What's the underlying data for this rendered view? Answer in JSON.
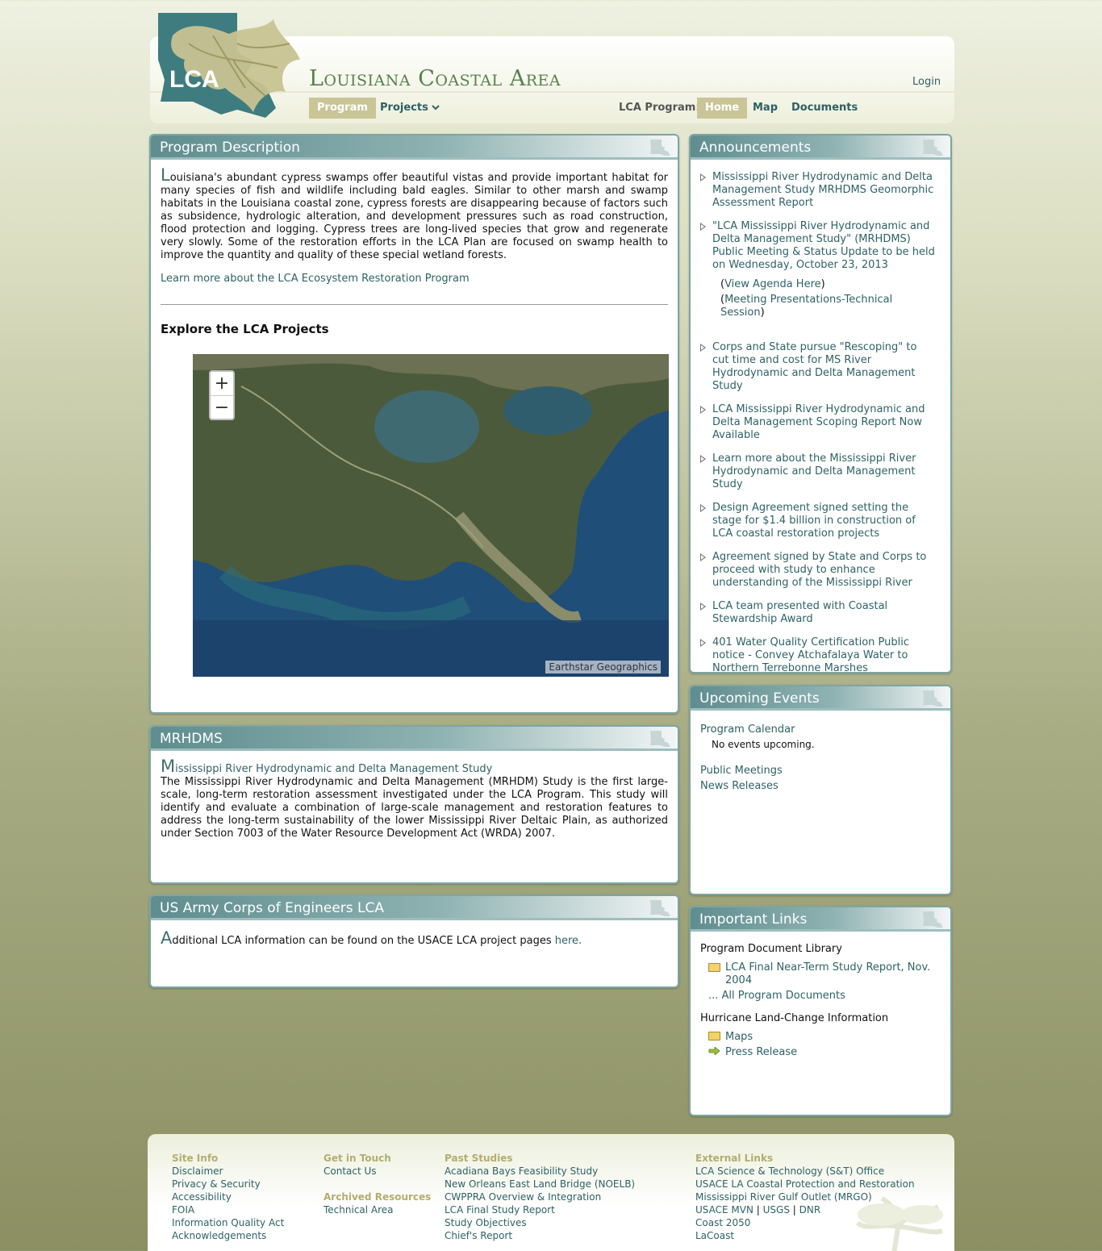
{
  "header": {
    "site_title": "Louisiana Coastal Area",
    "logo_text": "LCA",
    "login": "Login",
    "nav": {
      "program": "Program",
      "projects": "Projects",
      "label": "LCA Program:",
      "home": "Home",
      "map": "Map",
      "documents": "Documents"
    }
  },
  "program": {
    "title": "Program Description",
    "dropcap": "L",
    "text": "ouisiana's abundant cypress swamps offer beautiful vistas and provide important habitat for many species of fish and wildlife including bald eagles. Similar to other marsh and swamp habitats in the Louisiana coastal zone, cypress forests are disappearing because of factors such as subsidence, hydrologic alteration, and development pressures such as road construction, flood protection and logging. Cypress trees are long-lived species that grow and regenerate very slowly. Some of the restoration efforts in the LCA Plan are focused on swamp health to improve the quantity and quality of these special wetland forests.",
    "learn_more": "Learn more about the LCA Ecosystem Restoration Program",
    "explore": "Explore the LCA Projects",
    "map_attribution": "Earthstar Geographics",
    "zoom_in": "+",
    "zoom_out": "−"
  },
  "mrhdms": {
    "title": "MRHDMS",
    "dropcap": "M",
    "link": "ississippi River Hydrodynamic and Delta Management Study",
    "text": "The Mississippi River Hydrodynamic and Delta Management (MRHDM) Study is the first large-scale, long-term restoration assessment investigated under the LCA Program. This study will identify and evaluate a combination of large-scale management and restoration features to address the long-term sustainability of the lower Mississippi River Deltaic Plain, as authorized under Section 7003 of the Water Resource Development Act (WRDA) 2007."
  },
  "usace": {
    "title": "US Army Corps of Engineers LCA",
    "dropcap": "A",
    "text": "dditional LCA information can be found on the USACE LCA project pages ",
    "link": "here."
  },
  "announcements": {
    "title": "Announcements",
    "items": [
      "Mississippi River Hydrodynamic and Delta Management Study MRHDMS Geomorphic Assessment Report",
      "\"LCA Mississippi River Hydrodynamic and Delta Management Study\" (MRHDMS) Public Meeting & Status Update to be held on Wednesday, October 23, 2013",
      "Corps and State pursue \"Rescoping\" to cut time and cost for MS River Hydrodynamic and Delta Management Study",
      "LCA Mississippi River Hydrodynamic and Delta Management Scoping Report Now Available",
      "Learn more about the Mississippi River Hydrodynamic and Delta Management Study",
      "Design Agreement signed setting the stage for $1.4 billion in construction of LCA coastal restoration projects",
      "Agreement signed by State and Corps to proceed with study to enhance understanding of the Mississippi River",
      "LCA team presented with Coastal Stewardship Award",
      "401 Water Quality Certification Public notice - Convey Atchafalaya Water to Northern Terrebonne Marshes"
    ],
    "sub_links": {
      "agenda": "View Agenda Here",
      "presentations": "Meeting Presentations-Technical Session"
    }
  },
  "events": {
    "title": "Upcoming Events",
    "calendar": "Program Calendar",
    "none": "No events upcoming.",
    "public_meetings": "Public Meetings",
    "news": "News Releases"
  },
  "links": {
    "title": "Important Links",
    "library": "Program Document Library",
    "report": "LCA Final Near-Term Study Report, Nov. 2004",
    "all_docs": "... All Program Documents",
    "hurricane": "Hurricane Land-Change Information",
    "maps": "Maps",
    "press": "Press Release"
  },
  "footer": {
    "site_info": {
      "heading": "Site Info",
      "items": [
        "Disclaimer",
        "Privacy & Security",
        "Accessibility",
        "FOIA",
        "Information Quality Act",
        "Acknowledgements"
      ]
    },
    "touch": {
      "heading": "Get in Touch",
      "items": [
        "Contact Us"
      ]
    },
    "archived": {
      "heading": "Archived Resources",
      "items": [
        "Technical Area"
      ]
    },
    "past": {
      "heading": "Past Studies",
      "items": [
        "Acadiana Bays Feasibility Study",
        "New Orleans East Land Bridge (NOELB)",
        "CWPPRA Overview & Integration",
        "LCA Final Study Report",
        "Study Objectives",
        "Chief's Report"
      ]
    },
    "external": {
      "heading": "External Links",
      "items": [
        "LCA Science & Technology (S&T) Office",
        "USACE LA Coastal Protection and Restoration",
        "Mississippi River Gulf Outlet (MRGO)"
      ],
      "usace_mvn": "USACE MVN",
      "usgs": "USGS",
      "dnr": "DNR",
      "sep": "|",
      "coast": "Coast 2050",
      "lacoast": "LaCoast"
    }
  }
}
